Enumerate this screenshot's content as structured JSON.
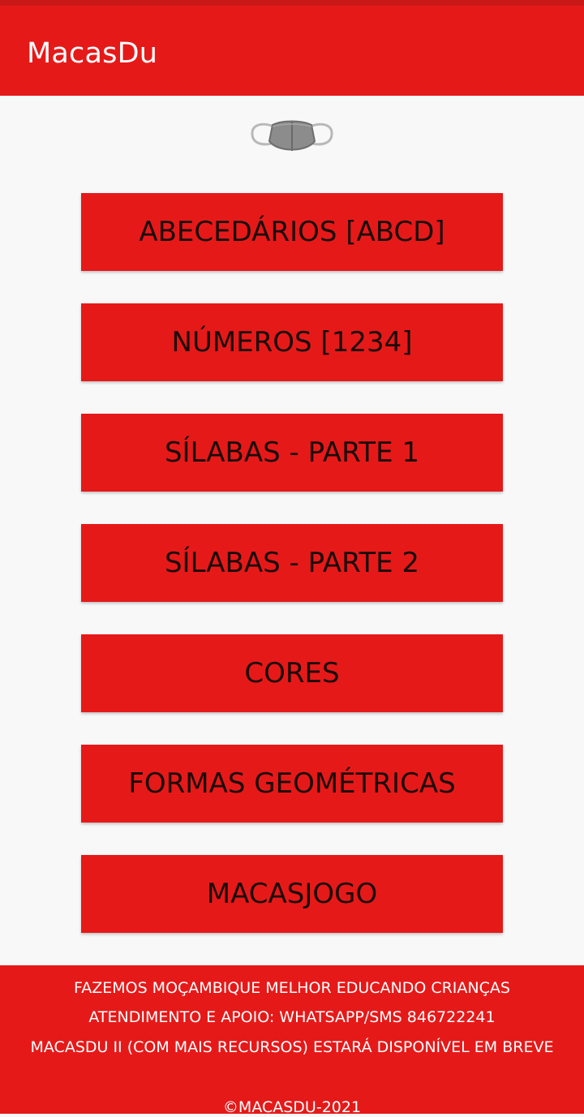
{
  "app_bar": {
    "title": "MacasDu",
    "accent_color": "#e61919"
  },
  "logo": {
    "icon": "face-mask-icon"
  },
  "menu": {
    "buttons": [
      {
        "label": "ABECEDÁRIOS [ABCD]"
      },
      {
        "label": "NÚMEROS [1234]"
      },
      {
        "label": "SÍLABAS - PARTE 1"
      },
      {
        "label": "SÍLABAS - PARTE 2"
      },
      {
        "label": "CORES"
      },
      {
        "label": "FORMAS GEOMÉTRICAS"
      },
      {
        "label": "MACASJOGO"
      }
    ]
  },
  "footer": {
    "line1": "FAZEMOS MOÇAMBIQUE MELHOR EDUCANDO CRIANÇAS",
    "line2": "ATENDIMENTO E APOIO: WHATSAPP/SMS 846722241",
    "line3": "MACASDU II (COM MAIS RECURSOS) ESTARÁ DISPONÍVEL EM BREVE",
    "copyright": "©MACASDU-2021"
  }
}
